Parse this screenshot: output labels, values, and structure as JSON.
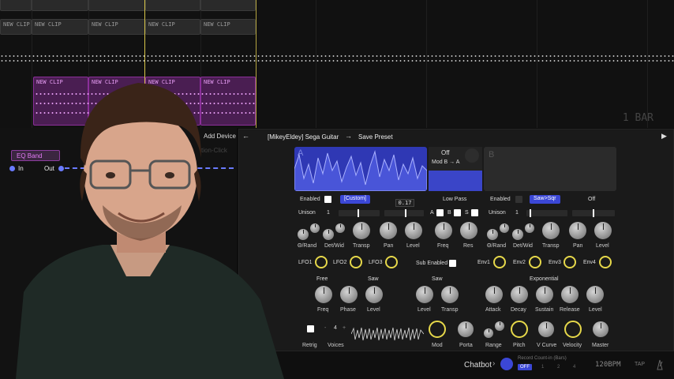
{
  "arrangement": {
    "clip_label": "NEW CLIP",
    "bar_label": "1 BAR"
  },
  "device": {
    "eq_band": "EQ Band",
    "in_label": "In",
    "out_label": "Out",
    "add_device": "Add Device",
    "faded_label": "tion-Click"
  },
  "synth": {
    "preset_name": "[MikeyEldey] Sega Guitar",
    "save_preset": "Save Preset",
    "osc_a_letter": "A",
    "osc_b_letter": "B",
    "mod_off": "Off",
    "mod_b_to_a": "Mod B → A",
    "left": {
      "enabled": "Enabled",
      "waveform": "[Custom]",
      "unison": "Unison",
      "unison_value": "1",
      "knobs": [
        "Θ/Rand",
        "Det/Wid",
        "Transp",
        "Pan",
        "Level"
      ]
    },
    "filter": {
      "type": "Low Pass",
      "knobs": [
        "Freq",
        "Res"
      ],
      "abs": [
        "A",
        "B",
        "S"
      ],
      "tooltip": "0.17"
    },
    "right": {
      "enabled": "Enabled",
      "waveform": "Saw>Sqr",
      "off": "Off",
      "unison": "Unison",
      "unison_value": "1",
      "knobs": [
        "Θ/Rand",
        "Det/Wid",
        "Transp",
        "Pan",
        "Level"
      ]
    },
    "lfos": [
      "LFO1",
      "LFO2",
      "LFO3"
    ],
    "sub_enabled": "Sub Enabled",
    "envs": [
      "Env1",
      "Env2",
      "Env3",
      "Env4"
    ],
    "lfo_section": {
      "mode": "Free",
      "shape": "Saw",
      "knobs": [
        "Freq",
        "Phase",
        "Level"
      ]
    },
    "sub_section": {
      "shape": "Saw",
      "knobs": [
        "Level",
        "Transp"
      ]
    },
    "env_section": {
      "curve": "Exponential",
      "knobs": [
        "Attack",
        "Decay",
        "Sustain",
        "Release",
        "Level"
      ]
    },
    "bottom": {
      "retrig": "Retrig",
      "voices": "Voices",
      "voices_value": "4",
      "knobs": [
        "Mod",
        "Porta",
        "Range",
        "Pitch",
        "V Curve",
        "Velocity",
        "Master"
      ]
    }
  },
  "status": {
    "chatbot": "Chatbot",
    "record_label": "Record Count-in (Bars)",
    "record_off": "OFF",
    "record_values": [
      "1",
      "2",
      "4"
    ],
    "bpm": "120BPM",
    "tap": "TAP"
  },
  "colors": {
    "accent_blue": "#3b47d6",
    "accent_yellow": "#e6d84a",
    "clip_pink": "#8b2f9a"
  }
}
